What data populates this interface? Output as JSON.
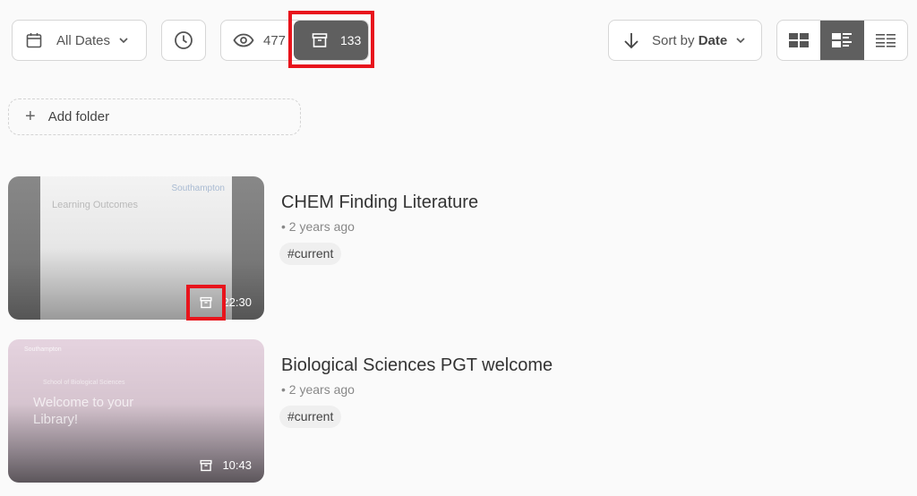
{
  "toolbar": {
    "date_filter": "All Dates",
    "views_count": "477",
    "archived_count": "133",
    "sort_prefix": "Sort by ",
    "sort_field": "Date",
    "view_modes": [
      "grid",
      "detailed-list",
      "compact-list"
    ],
    "active_view": "detailed-list",
    "active_color": "#5f5f5f"
  },
  "add_folder": "Add folder",
  "highlight_color": "#e8141c",
  "videos": [
    {
      "title": "CHEM Finding Literature",
      "age": "2 years ago",
      "tag": "#current",
      "duration": "22:30",
      "slide": {
        "logo": "Southampton",
        "heading": "Learning Outcomes"
      }
    },
    {
      "title": "Biological Sciences PGT welcome",
      "age": "2 years ago",
      "tag": "#current",
      "duration": "10:43",
      "slide": {
        "logo": "Southampton",
        "school": "School of Biological Sciences",
        "heading": "Welcome to your Library!"
      }
    }
  ]
}
